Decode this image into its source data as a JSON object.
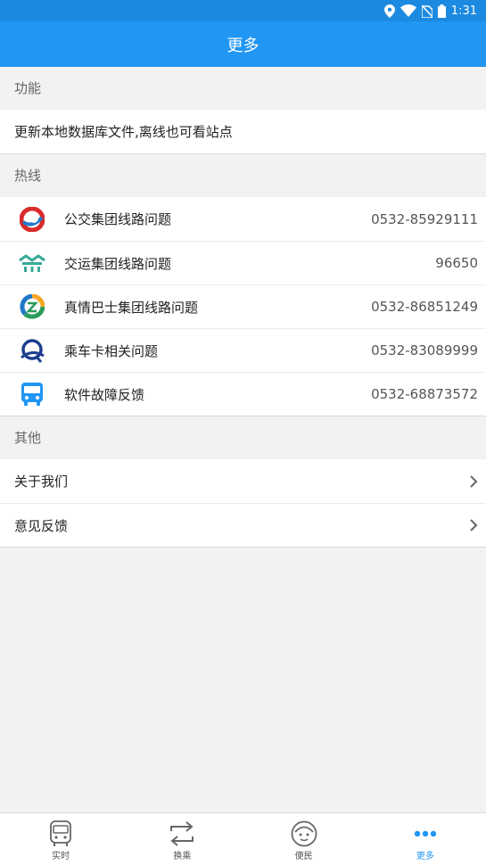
{
  "status_bar": {
    "time": "1:31"
  },
  "header": {
    "title": "更多"
  },
  "sections": {
    "features": {
      "title": "功能",
      "items": [
        {
          "label": "更新本地数据库文件,离线也可看站点"
        }
      ]
    },
    "hotline": {
      "title": "热线",
      "items": [
        {
          "label": "公交集团线路问题",
          "phone": "0532-85929111",
          "icon": "bus-group-logo-icon"
        },
        {
          "label": "交运集团线路问题",
          "phone": "96650",
          "icon": "transport-group-logo-icon"
        },
        {
          "label": "真情巴士集团线路问题",
          "phone": "0532-86851249",
          "icon": "zhenqing-bus-logo-icon"
        },
        {
          "label": "乘车卡相关问题",
          "phone": "0532-83089999",
          "icon": "bus-card-logo-icon"
        },
        {
          "label": "软件故障反馈",
          "phone": "0532-68873572",
          "icon": "app-bus-icon"
        }
      ]
    },
    "other": {
      "title": "其他",
      "items": [
        {
          "label": "关于我们"
        },
        {
          "label": "意见反馈"
        }
      ]
    }
  },
  "tabs": [
    {
      "label": "实时",
      "icon": "bus-icon",
      "active": false
    },
    {
      "label": "换乘",
      "icon": "transfer-icon",
      "active": false
    },
    {
      "label": "便民",
      "icon": "face-icon",
      "active": false
    },
    {
      "label": "更多",
      "icon": "more-dots-icon",
      "active": true
    }
  ],
  "colors": {
    "primary": "#2196f3",
    "status_bar": "#1c8ae0"
  }
}
